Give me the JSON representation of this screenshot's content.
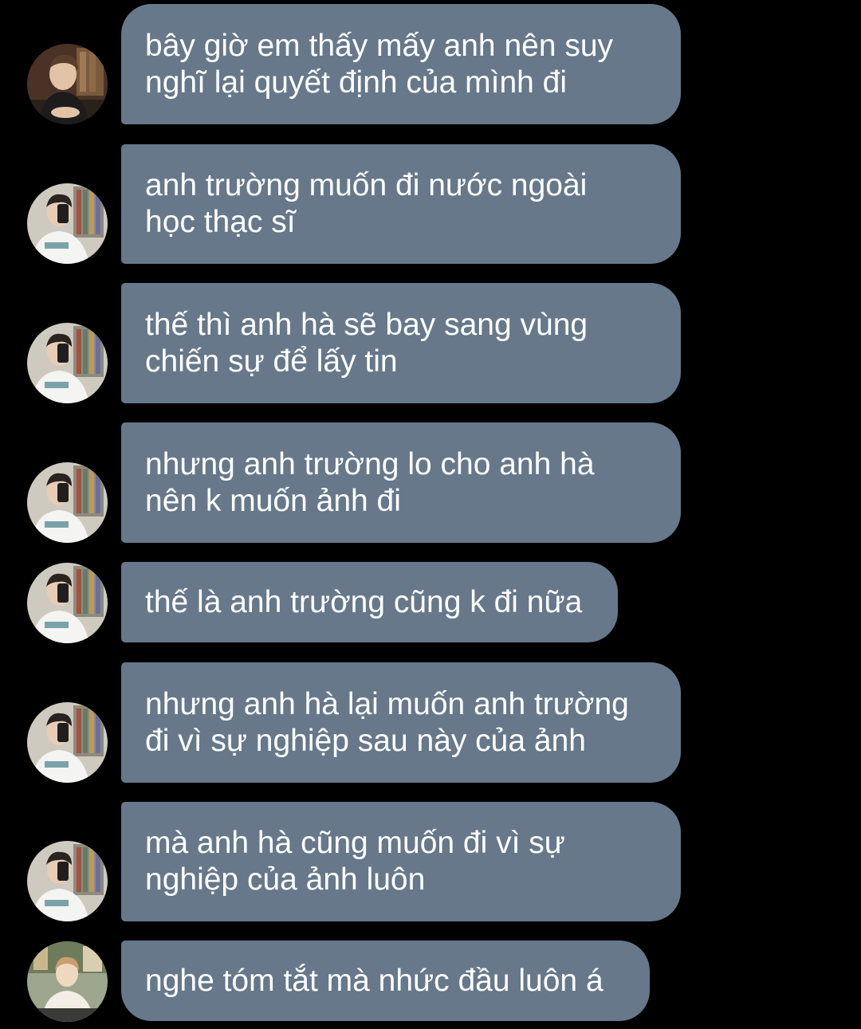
{
  "colors": {
    "background": "#000000",
    "bubble": "#66788a",
    "text": "#ffffff"
  },
  "messages": [
    {
      "avatar": "avatar-a",
      "lines": [
        "bây giờ em thấy mấy anh nên suy",
        "nghĩ lại quyết định của mình đi"
      ]
    },
    {
      "avatar": "avatar-b",
      "lines": [
        "anh trường muốn đi nước ngoài",
        "học thạc sĩ"
      ]
    },
    {
      "avatar": "avatar-b",
      "lines": [
        "thế thì anh hà sẽ bay sang vùng",
        "chiến sự để lấy tin"
      ]
    },
    {
      "avatar": "avatar-b",
      "lines": [
        "nhưng anh trường lo cho anh hà",
        "nên k muốn ảnh đi"
      ]
    },
    {
      "avatar": "avatar-b",
      "lines": [
        "thế là anh trường cũng k đi nữa"
      ]
    },
    {
      "avatar": "avatar-b",
      "lines": [
        "nhưng anh hà lại muốn anh trường",
        "đi vì sự nghiệp sau này của ảnh"
      ]
    },
    {
      "avatar": "avatar-b",
      "lines": [
        "mà anh hà cũng muốn đi vì sự",
        "nghiệp của ảnh luôn"
      ]
    },
    {
      "avatar": "avatar-c",
      "lines": [
        "nghe tóm tắt mà nhức đầu luôn á"
      ]
    }
  ]
}
